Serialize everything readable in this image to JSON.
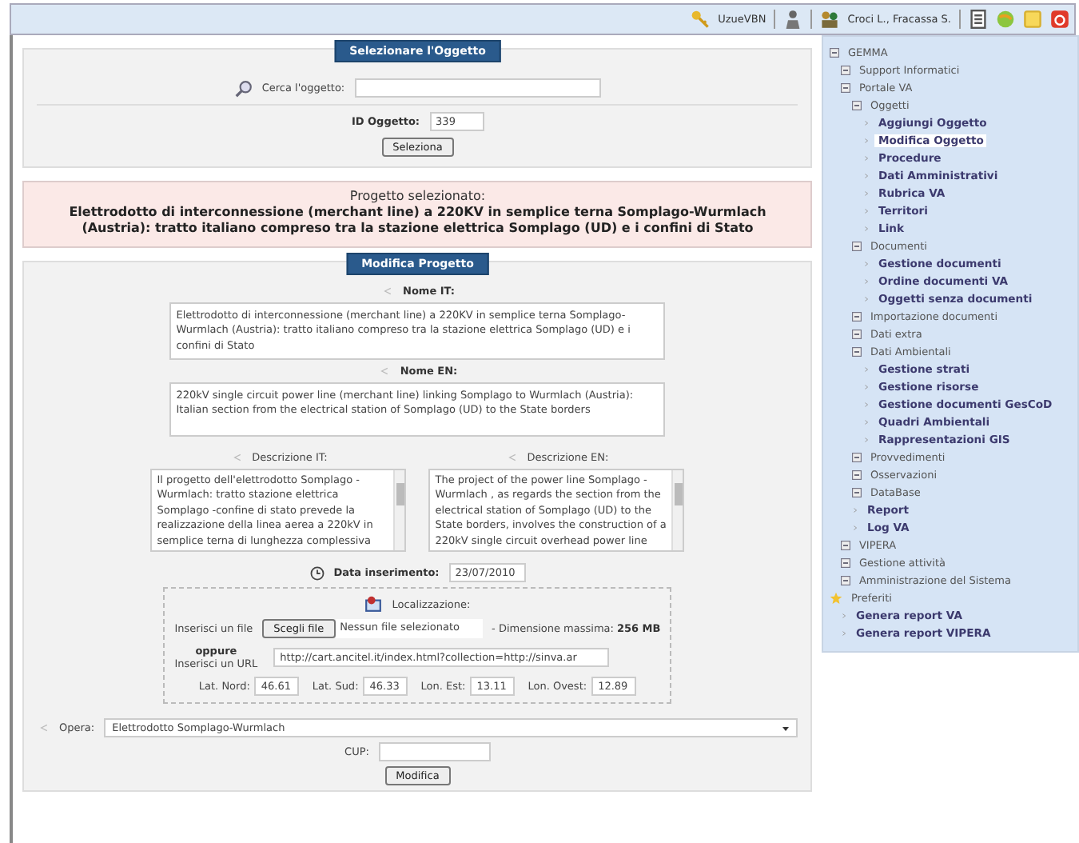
{
  "top_bar": {
    "user_code": "UzueVBN",
    "users": "Croci L., Fracassa S."
  },
  "select_panel": {
    "title": "Selezionare l'Oggetto",
    "search_label": "Cerca l'oggetto:",
    "id_label": "ID Oggetto:",
    "id_value": "339",
    "button": "Seleziona"
  },
  "selected_project": {
    "caption": "Progetto selezionato:",
    "name": "Elettrodotto di interconnessione (merchant line) a 220KV in semplice terna Somplago-Wurmlach (Austria): tratto italiano compreso tra la stazione elettrica Somplago (UD) e i confini di Stato"
  },
  "edit_panel": {
    "title": "Modifica Progetto",
    "name_it": {
      "label": "Nome IT:",
      "value": "Elettrodotto di interconnessione (merchant line) a 220KV in semplice terna Somplago-Wurmlach (Austria): tratto italiano compreso tra la stazione elettrica Somplago (UD) e i confini di Stato"
    },
    "name_en": {
      "label": "Nome EN:",
      "value": "220kV single circuit power line (merchant line) linking Somplago to Wurmlach (Austria): Italian section from the electrical station of Somplago (UD) to the State borders"
    },
    "desc_it": {
      "label": "Descrizione IT:",
      "value": "Il progetto dell'elettrodotto Somplago - Wurmlach: tratto stazione elettrica Somplago -confine di stato prevede la realizzazione della linea aerea a 220kV in semplice terna di lunghezza complessiva"
    },
    "desc_en": {
      "label": "Descrizione EN:",
      "value": "The project of the power line Somplago - Wurmlach , as regards the section from the electrical station of Somplago (UD) to the State borders, involves the construction of a 220kV single circuit overhead power line"
    },
    "date": {
      "label": "Data inserimento:",
      "value": "23/07/2010"
    },
    "location": {
      "title": "Localizzazione:",
      "file_label": "Inserisci un file",
      "file_button": "Scegli file",
      "file_status": "Nessun file selezionato",
      "max_size_label": "- Dimensione massima:",
      "max_size": "256 MB",
      "or_label": "oppure",
      "url_label": "Inserisci un URL",
      "url_value": "http://cart.ancitel.it/index.html?collection=http://sinva.ar",
      "coords": [
        {
          "label": "Lat. Nord:",
          "value": "46.61"
        },
        {
          "label": "Lat. Sud:",
          "value": "46.33"
        },
        {
          "label": "Lon. Est:",
          "value": "13.11"
        },
        {
          "label": "Lon. Ovest:",
          "value": "12.89"
        }
      ]
    },
    "opera": {
      "label": "Opera:",
      "value": "Elettrodotto Somplago-Wurmlach"
    },
    "cup": {
      "label": "CUP:"
    },
    "button": "Modifica"
  },
  "sidebar": {
    "tree": [
      {
        "kind": "folder",
        "label": "GEMMA",
        "selected": false,
        "children": [
          {
            "kind": "folder",
            "label": "Support Informatici",
            "selected": false
          },
          {
            "kind": "folder",
            "label": "Portale VA",
            "selected": false,
            "children": [
              {
                "kind": "folder",
                "label": "Oggetti",
                "selected": false,
                "children": [
                  {
                    "kind": "link",
                    "label": "Aggiungi Oggetto",
                    "selected": false
                  },
                  {
                    "kind": "link",
                    "label": "Modifica Oggetto",
                    "selected": true
                  },
                  {
                    "kind": "link",
                    "label": "Procedure",
                    "selected": false
                  },
                  {
                    "kind": "link",
                    "label": "Dati Amministrativi",
                    "selected": false
                  },
                  {
                    "kind": "link",
                    "label": "Rubrica VA",
                    "selected": false
                  },
                  {
                    "kind": "link",
                    "label": "Territori",
                    "selected": false
                  },
                  {
                    "kind": "link",
                    "label": "Link",
                    "selected": false
                  }
                ]
              },
              {
                "kind": "folder",
                "label": "Documenti",
                "selected": false,
                "children": [
                  {
                    "kind": "link",
                    "label": "Gestione documenti",
                    "selected": false
                  },
                  {
                    "kind": "link",
                    "label": "Ordine documenti VA",
                    "selected": false
                  },
                  {
                    "kind": "link",
                    "label": "Oggetti senza documenti",
                    "selected": false
                  }
                ]
              },
              {
                "kind": "folder",
                "label": "Importazione documenti",
                "selected": false
              },
              {
                "kind": "folder",
                "label": "Dati extra",
                "selected": false
              },
              {
                "kind": "folder",
                "label": "Dati Ambientali",
                "selected": false,
                "children": [
                  {
                    "kind": "link",
                    "label": "Gestione strati",
                    "selected": false
                  },
                  {
                    "kind": "link",
                    "label": "Gestione risorse",
                    "selected": false
                  },
                  {
                    "kind": "link",
                    "label": "Gestione documenti GesCoD",
                    "selected": false
                  },
                  {
                    "kind": "link",
                    "label": "Quadri Ambientali",
                    "selected": false
                  },
                  {
                    "kind": "link",
                    "label": "Rappresentazioni GIS",
                    "selected": false
                  }
                ]
              },
              {
                "kind": "folder",
                "label": "Provvedimenti",
                "selected": false
              },
              {
                "kind": "folder",
                "label": "Osservazioni",
                "selected": false
              },
              {
                "kind": "folder",
                "label": "DataBase",
                "selected": false
              },
              {
                "kind": "link",
                "label": "Report",
                "selected": false
              },
              {
                "kind": "link",
                "label": "Log VA",
                "selected": false
              }
            ]
          },
          {
            "kind": "folder",
            "label": "VIPERA",
            "selected": false
          },
          {
            "kind": "folder",
            "label": "Gestione attività",
            "selected": false
          },
          {
            "kind": "folder",
            "label": "Amministrazione del Sistema",
            "selected": false
          }
        ]
      },
      {
        "kind": "star",
        "label": "Preferiti",
        "selected": false,
        "children": [
          {
            "kind": "link",
            "label": "Genera report VA",
            "selected": false
          },
          {
            "kind": "link",
            "label": "Genera report VIPERA",
            "selected": false
          }
        ]
      }
    ]
  }
}
